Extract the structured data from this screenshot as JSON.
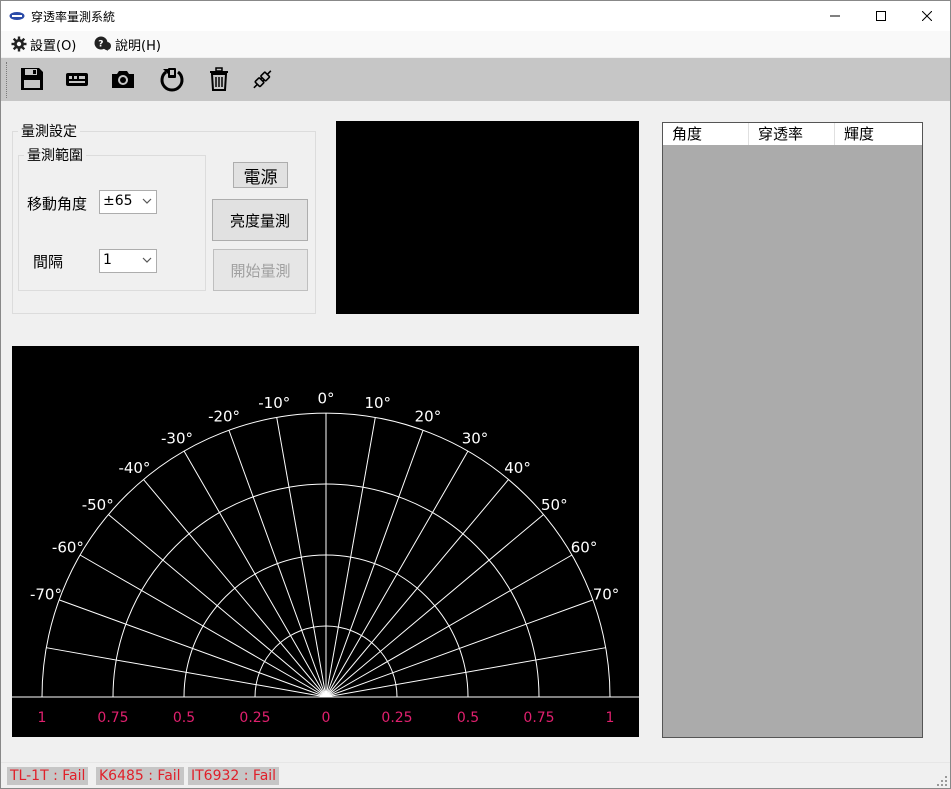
{
  "window": {
    "title": "穿透率量測系統"
  },
  "menu": {
    "settings": "設置(O)",
    "help": "說明(H)"
  },
  "toolbar": {
    "items": [
      "save-icon",
      "device-icon",
      "camera-icon",
      "power-cycle-icon",
      "trash-icon",
      "plug-icon"
    ]
  },
  "measure_settings": {
    "group_title": "量測設定",
    "range_group_title": "量測範圍",
    "angle_label": "移動角度",
    "angle_value": "±65",
    "interval_label": "間隔",
    "interval_value": "1",
    "power_button": "電源",
    "brightness_button": "亮度量測",
    "start_button": "開始量測"
  },
  "table": {
    "columns": [
      "角度",
      "穿透率",
      "輝度"
    ]
  },
  "polar": {
    "angle_labels": [
      "-70°",
      "-60°",
      "-50°",
      "-40°",
      "-30°",
      "-20°",
      "-10°",
      "0°",
      "10°",
      "20°",
      "30°",
      "40°",
      "50°",
      "60°",
      "70°"
    ],
    "radial_labels": [
      "1",
      "0.75",
      "0.5",
      "0.25",
      "0",
      "0.25",
      "0.5",
      "0.75",
      "1"
    ],
    "label_color": "#ffffff",
    "radial_color": "#e0206e"
  },
  "status": [
    "TL-1T : Fail",
    "K6485 : Fail",
    "IT6932 : Fail"
  ],
  "colors": {
    "status_text": "#e0202a",
    "toolbar_bg": "#c6c6c6"
  }
}
